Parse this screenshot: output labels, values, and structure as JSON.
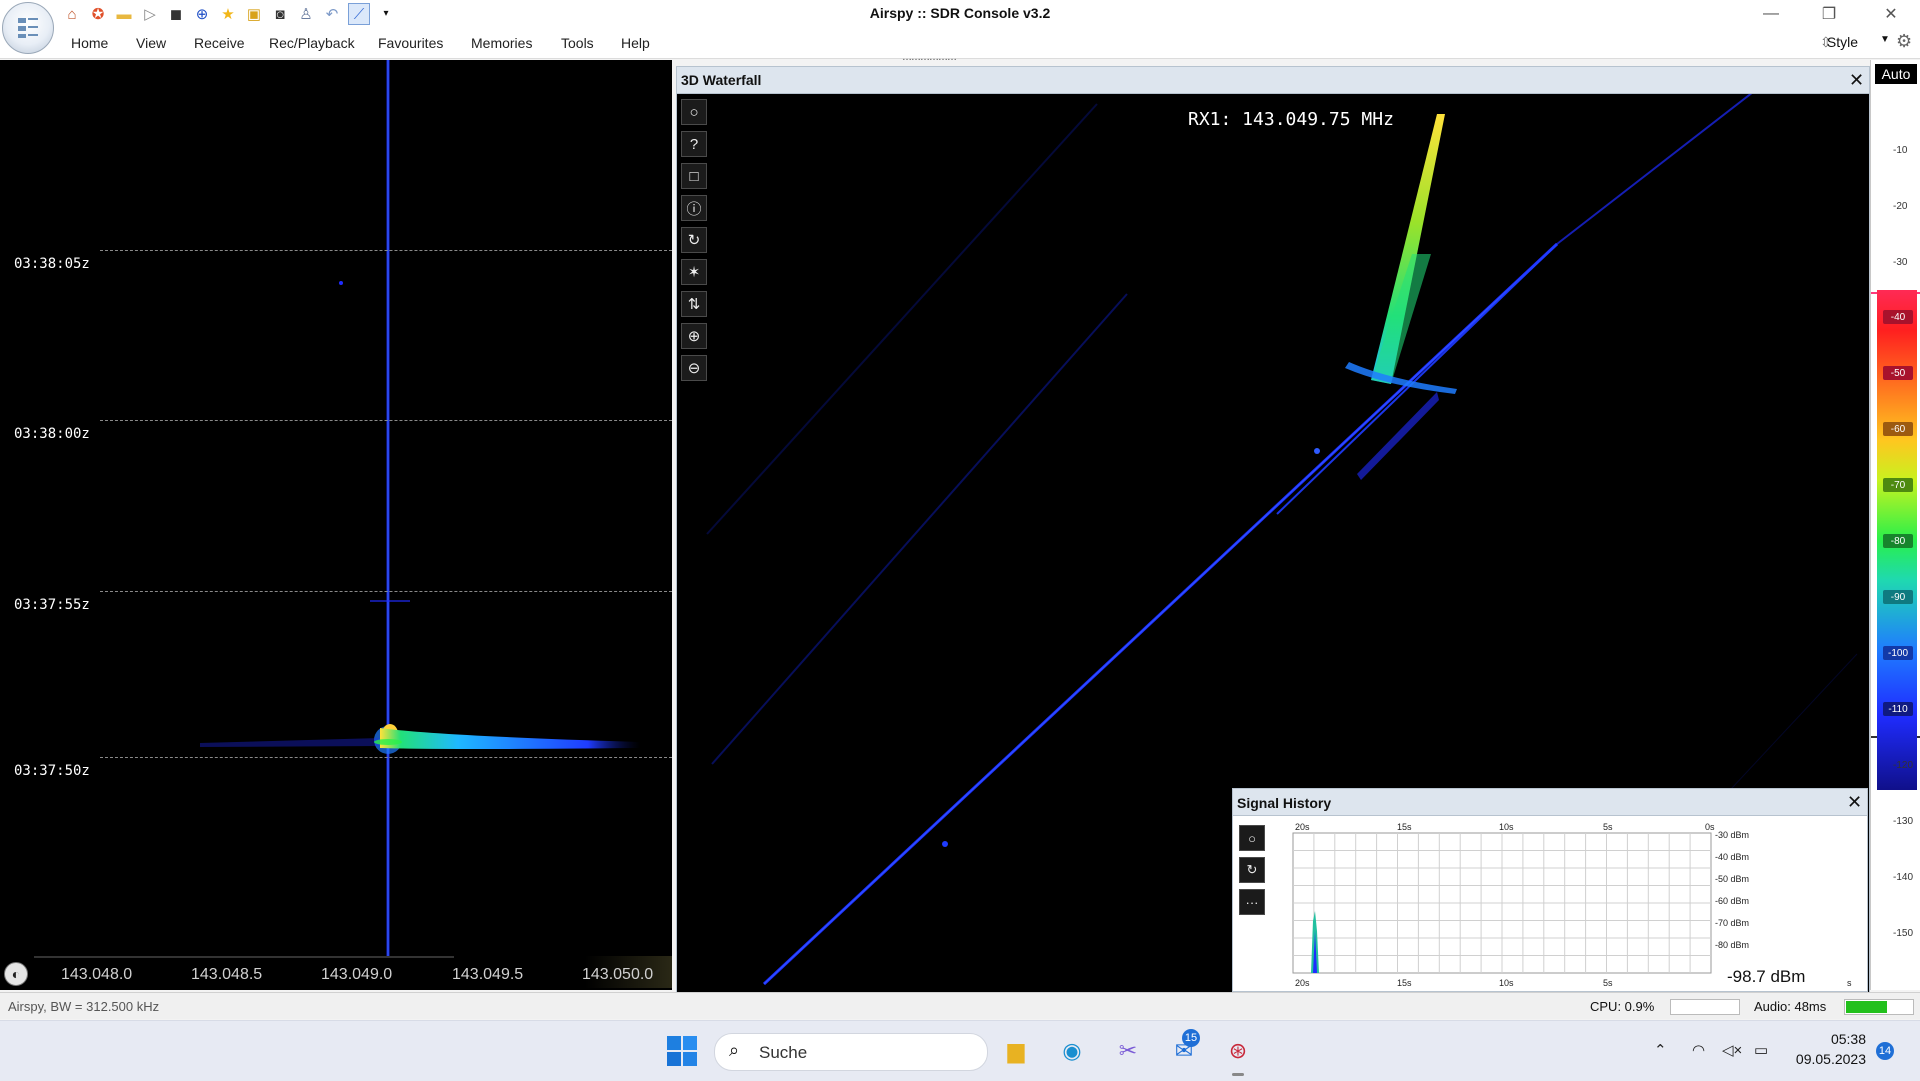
{
  "window": {
    "title": "Airspy :: SDR Console v3.2"
  },
  "menu": [
    "Home",
    "View",
    "Receive",
    "Rec/Playback",
    "Favourites",
    "Memories",
    "Tools",
    "Help"
  ],
  "style_menu": {
    "label": "Style"
  },
  "spectrum": {
    "timestamps": [
      "03:38:05z",
      "03:38:00z",
      "03:37:55z",
      "03:37:50z"
    ],
    "freq_labels": [
      "143.048.0",
      "143.048.5",
      "143.049.0",
      "143.049.5",
      "143.050.0"
    ]
  },
  "waterfall3d": {
    "title": "3D Waterfall",
    "rx_readout": "RX1: 143.049.75 MHz"
  },
  "signal_history": {
    "title": "Signal History",
    "time_labels": [
      "20s",
      "15s",
      "10s",
      "5s",
      "0s"
    ],
    "bottom_time_labels": [
      "20s",
      "15s",
      "10s",
      "5s"
    ],
    "dbm_labels": [
      "-30 dBm",
      "-40 dBm",
      "-50 dBm",
      "-60 dBm",
      "-70 dBm",
      "-80 dBm"
    ],
    "current_value": "-98.7 dBm",
    "unit_suffix": "s"
  },
  "level_bar": {
    "auto_label": "Auto",
    "ticks": [
      "-10",
      "-20",
      "-30",
      "-40",
      "-50",
      "-60",
      "-70",
      "-80",
      "-90",
      "-100",
      "-110",
      "-120",
      "-130",
      "-140",
      "-150"
    ]
  },
  "statusbar": {
    "left_text": "Airspy, BW = 312.500 kHz",
    "cpu": "CPU: 0.9%",
    "audio": "Audio: 48ms",
    "audio_level_fraction": 0.62
  },
  "taskbar": {
    "search_placeholder": "Suche",
    "mail_badge": "15",
    "time": "05:38",
    "date": "09.05.2023",
    "notification_badge": "14"
  },
  "colors": {
    "accent": "#1f6fd6",
    "panel_header": "#dde5ee",
    "signal_blue": "#1f2cff"
  }
}
